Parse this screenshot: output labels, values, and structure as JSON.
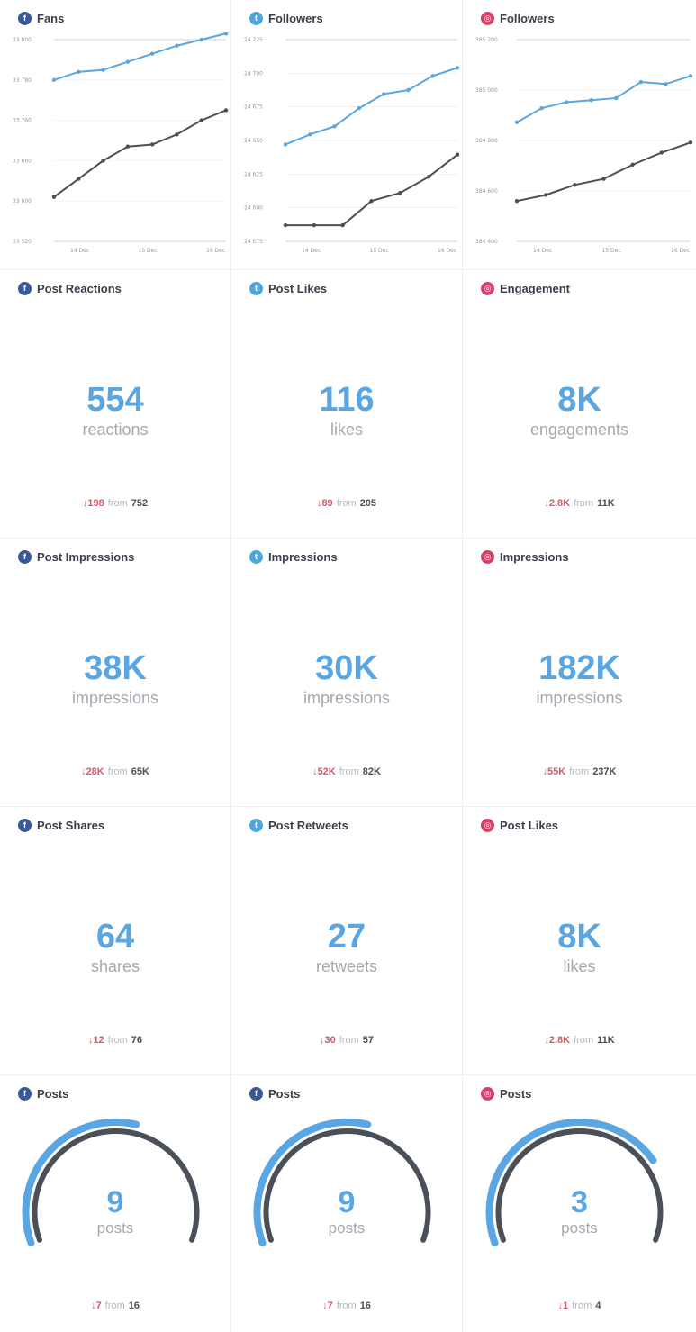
{
  "colors": {
    "facebook": "#3b5998",
    "twitter": "#4da7de",
    "instagram": "#d4406a",
    "value": "#5aa6e2",
    "decrease": "#d05a69",
    "line_primary": "#5aa6e2",
    "line_secondary": "#4a4f58"
  },
  "charts": [
    {
      "network": "facebook",
      "icon": "facebook-icon",
      "title": "Fans",
      "chart_data": {
        "type": "line",
        "y_ticks": [
          "33 800",
          "33 780",
          "33 760",
          "33 660",
          "33 600",
          "33 520"
        ],
        "x_ticks": [
          "14 Dec",
          "15 Dec",
          "16 Dec"
        ],
        "series": [
          {
            "values": [
              0.8,
              0.84,
              0.85,
              0.89,
              0.93,
              0.97,
              1.0,
              1.03
            ]
          },
          {
            "values": [
              0.22,
              0.31,
              0.4,
              0.47,
              0.48,
              0.53,
              0.6,
              0.65
            ]
          }
        ]
      }
    },
    {
      "network": "twitter",
      "icon": "twitter-icon",
      "title": "Followers",
      "chart_data": {
        "type": "line",
        "y_ticks": [
          "24 725",
          "24 700",
          "24 675",
          "24 650",
          "24 625",
          "24 600",
          "24 575"
        ],
        "x_ticks": [
          "14 Dec",
          "15 Dec",
          "16 Dec"
        ],
        "series": [
          {
            "values": [
              0.48,
              0.53,
              0.57,
              0.66,
              0.73,
              0.75,
              0.82,
              0.86
            ]
          },
          {
            "values": [
              0.08,
              0.08,
              0.08,
              0.2,
              0.24,
              0.32,
              0.43
            ]
          }
        ]
      }
    },
    {
      "network": "instagram",
      "icon": "instagram-icon",
      "title": "Followers",
      "chart_data": {
        "type": "line",
        "y_ticks": [
          "385 200",
          "385 000",
          "384 800",
          "384 600",
          "384 400"
        ],
        "x_ticks": [
          "14 Dec",
          "15 Dec",
          "16 Dec"
        ],
        "series": [
          {
            "values": [
              0.59,
              0.66,
              0.69,
              0.7,
              0.71,
              0.79,
              0.78,
              0.82
            ]
          },
          {
            "values": [
              0.2,
              0.23,
              0.28,
              0.31,
              0.38,
              0.44,
              0.49
            ]
          }
        ]
      }
    }
  ],
  "metrics": [
    {
      "network": "facebook",
      "icon": "facebook-icon",
      "title": "Post Reactions",
      "value": "554",
      "unit": "reactions",
      "delta": "↓198",
      "from": "from",
      "prev": "752"
    },
    {
      "network": "twitter",
      "icon": "twitter-icon",
      "title": "Post Likes",
      "value": "116",
      "unit": "likes",
      "delta": "↓89",
      "from": "from",
      "prev": "205"
    },
    {
      "network": "instagram",
      "icon": "instagram-icon",
      "title": "Engagement",
      "value": "8K",
      "unit": "engagements",
      "delta": "↓2.8K",
      "from": "from",
      "prev": "11K"
    },
    {
      "network": "facebook",
      "icon": "facebook-icon",
      "title": "Post Impressions",
      "value": "38K",
      "unit": "impressions",
      "delta": "↓28K",
      "from": "from",
      "prev": "65K"
    },
    {
      "network": "twitter",
      "icon": "twitter-icon",
      "title": "Impressions",
      "value": "30K",
      "unit": "impressions",
      "delta": "↓52K",
      "from": "from",
      "prev": "82K"
    },
    {
      "network": "instagram",
      "icon": "instagram-icon",
      "title": "Impressions",
      "value": "182K",
      "unit": "impressions",
      "delta": "↓55K",
      "from": "from",
      "prev": "237K"
    },
    {
      "network": "facebook",
      "icon": "facebook-icon",
      "title": "Post Shares",
      "value": "64",
      "unit": "shares",
      "delta": "↓12",
      "from": "from",
      "prev": "76"
    },
    {
      "network": "twitter",
      "icon": "twitter-icon",
      "title": "Post Retweets",
      "value": "27",
      "unit": "retweets",
      "delta": "↓30",
      "from": "from",
      "prev": "57"
    },
    {
      "network": "instagram",
      "icon": "instagram-icon",
      "title": "Post Likes",
      "value": "8K",
      "unit": "likes",
      "delta": "↓2.8K",
      "from": "from",
      "prev": "11K"
    }
  ],
  "gauges": [
    {
      "network": "facebook",
      "icon": "facebook-icon",
      "title": "Posts",
      "value": "9",
      "unit": "posts",
      "delta": "↓7",
      "from": "from",
      "prev": "16",
      "fraction": 0.56,
      "prev_fraction": 1.0
    },
    {
      "network": "facebook",
      "icon": "facebook-icon",
      "title": "Posts",
      "value": "9",
      "unit": "posts",
      "delta": "↓7",
      "from": "from",
      "prev": "16",
      "fraction": 0.56,
      "prev_fraction": 1.0
    },
    {
      "network": "instagram",
      "icon": "instagram-icon",
      "title": "Posts",
      "value": "3",
      "unit": "posts",
      "delta": "↓1",
      "from": "from",
      "prev": "4",
      "fraction": 0.75,
      "prev_fraction": 1.0
    }
  ]
}
